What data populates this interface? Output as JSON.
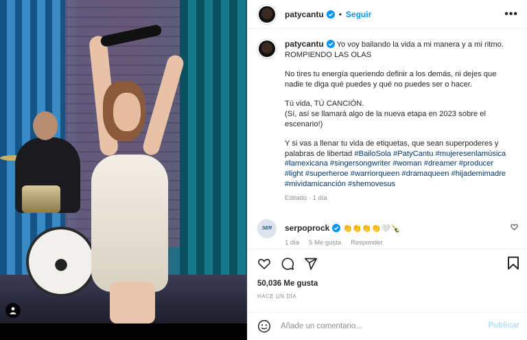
{
  "header": {
    "username": "patycantu",
    "separator": "•",
    "follow_label": "Seguir",
    "more_label": "•••"
  },
  "caption": {
    "username": "patycantu",
    "p1": "Yo voy bailando la vida a mi manera y a mi ritmo. ROMPIENDO LAS OLAS",
    "p2": "No tires tu energía queriendo definir a los demás, ni dejes que nadie te diga qué puedes y qué no puedes ser o hacer.",
    "p3a": "Tú vida, TÚ CANCIÓN.",
    "p3b": "(Sí, así se llamará algo de la nueva etapa en 2023 sobre el escenario!)",
    "p4": "Y si vas a llenar tu vida de etiquetas, que sean superpoderes y palabras de libertad",
    "hashtags": "#BailoSola #PatyCantu #mujeresenlamúsica #lamexicana #singersongwriter #woman #dreamer #producer #light #superheroe #warriorqueen #dramaqueen #hijademimadre #mividamicanción #shemovesus",
    "meta": "Editado · 1 día"
  },
  "reply": {
    "username": "serpoprock",
    "avatar_text": "SER",
    "text": "👏👏👏👏🤍🍾",
    "time": "1 día",
    "likes": "5 Me gusta",
    "reply_label": "Responder"
  },
  "actions": {
    "likes": "50,036 Me gusta",
    "time_ago": "HACE UN DÍA"
  },
  "comment_box": {
    "placeholder": "Añade un comentario...",
    "publish_label": "Publicar"
  },
  "colors": {
    "link_blue": "#0095f6",
    "hashtag": "#00376b",
    "muted": "#8e8e8e",
    "publish_disabled": "#b2dffc"
  }
}
